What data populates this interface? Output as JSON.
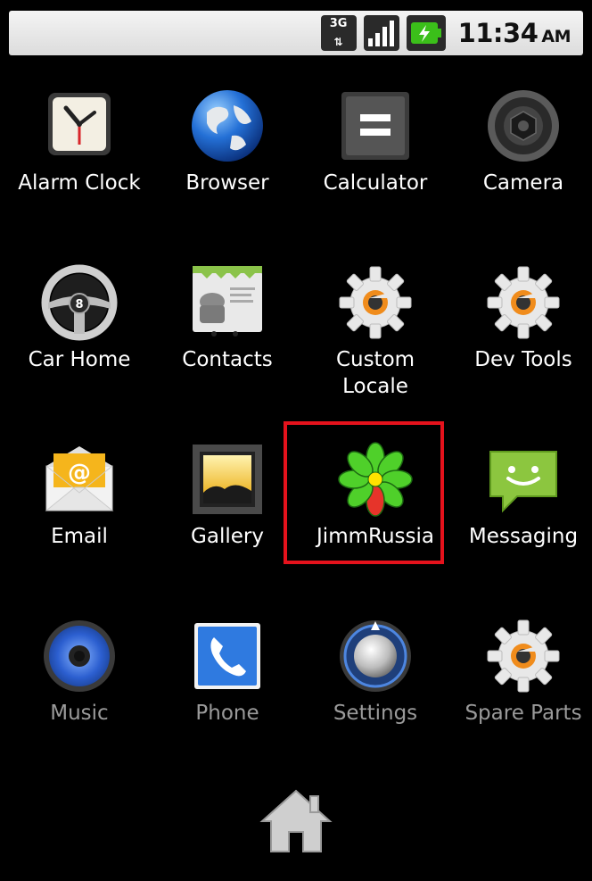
{
  "statusbar": {
    "network_type": "3G",
    "time": "11:34",
    "ampm": "AM"
  },
  "apps": [
    {
      "label": "Alarm Clock",
      "icon": "alarm-clock-icon"
    },
    {
      "label": "Browser",
      "icon": "globe-icon"
    },
    {
      "label": "Calculator",
      "icon": "calculator-icon"
    },
    {
      "label": "Camera",
      "icon": "camera-icon"
    },
    {
      "label": "Car Home",
      "icon": "steering-wheel-icon"
    },
    {
      "label": "Contacts",
      "icon": "contacts-icon"
    },
    {
      "label": "Custom Locale",
      "icon": "gear-icon"
    },
    {
      "label": "Dev Tools",
      "icon": "gear-icon"
    },
    {
      "label": "Email",
      "icon": "email-icon"
    },
    {
      "label": "Gallery",
      "icon": "gallery-icon"
    },
    {
      "label": "JimmRussia",
      "icon": "icq-flower-icon"
    },
    {
      "label": "Messaging",
      "icon": "messaging-icon"
    },
    {
      "label": "Music",
      "icon": "speaker-icon"
    },
    {
      "label": "Phone",
      "icon": "phone-icon"
    },
    {
      "label": "Settings",
      "icon": "settings-knob-icon"
    },
    {
      "label": "Spare Parts",
      "icon": "gear-icon"
    }
  ],
  "colors": {
    "highlight": "#e5121c",
    "label": "#ffffff",
    "label_dim": "#9a9a9a"
  }
}
